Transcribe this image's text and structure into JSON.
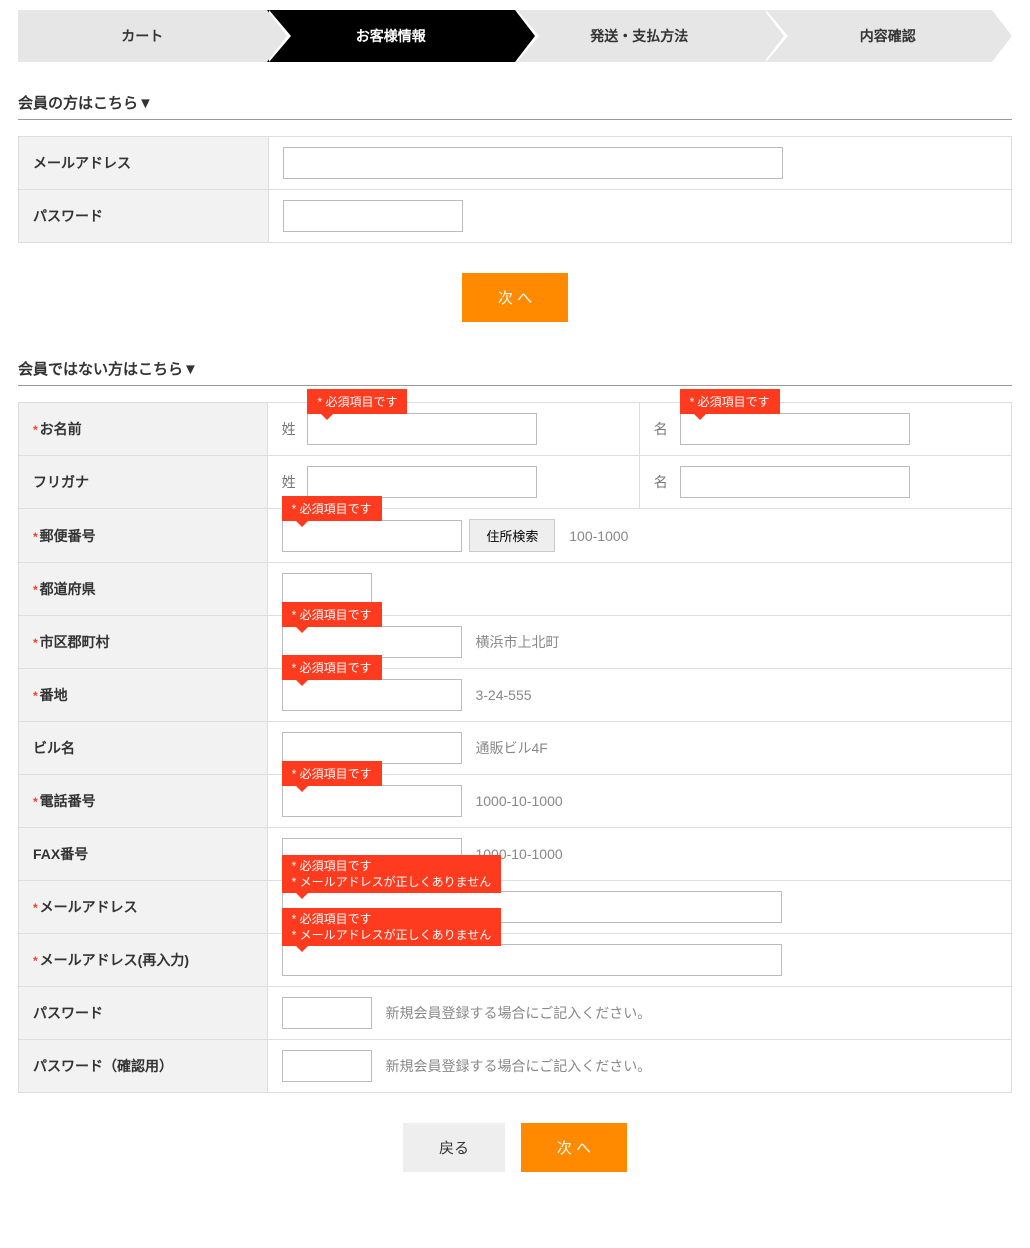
{
  "steps": [
    "カート",
    "お客様情報",
    "発送・支払方法",
    "内容確認"
  ],
  "member_section_title": "会員の方はこちら▼",
  "nonmember_section_title": "会員ではない方はこちら▼",
  "login": {
    "email_label": "メールアドレス",
    "password_label": "パスワード"
  },
  "buttons": {
    "next": "次 へ",
    "back": "戻る",
    "addr_search": "住所検索"
  },
  "errors": {
    "required": "* 必須項目です",
    "email_invalid": "* メールアドレスが正しくありません"
  },
  "form": {
    "name_label": "お名前",
    "furigana_label": "フリガナ",
    "sei": "姓",
    "mei": "名",
    "postal_label": "郵便番号",
    "postal_hint": "100-1000",
    "pref_label": "都道府県",
    "city_label": "市区郡町村",
    "city_hint": "横浜市上北町",
    "addr_label": "番地",
    "addr_hint": "3-24-555",
    "building_label": "ビル名",
    "building_hint": "通販ビル4F",
    "tel_label": "電話番号",
    "tel_hint": "1000-10-1000",
    "fax_label": "FAX番号",
    "fax_hint": "1000-10-1000",
    "email_label": "メールアドレス",
    "email2_label": "メールアドレス(再入力)",
    "password_label": "パスワード",
    "password_hint": "新規会員登録する場合にご記入ください。",
    "password2_label": "パスワード（確認用）",
    "password2_hint": "新規会員登録する場合にご記入ください。"
  }
}
